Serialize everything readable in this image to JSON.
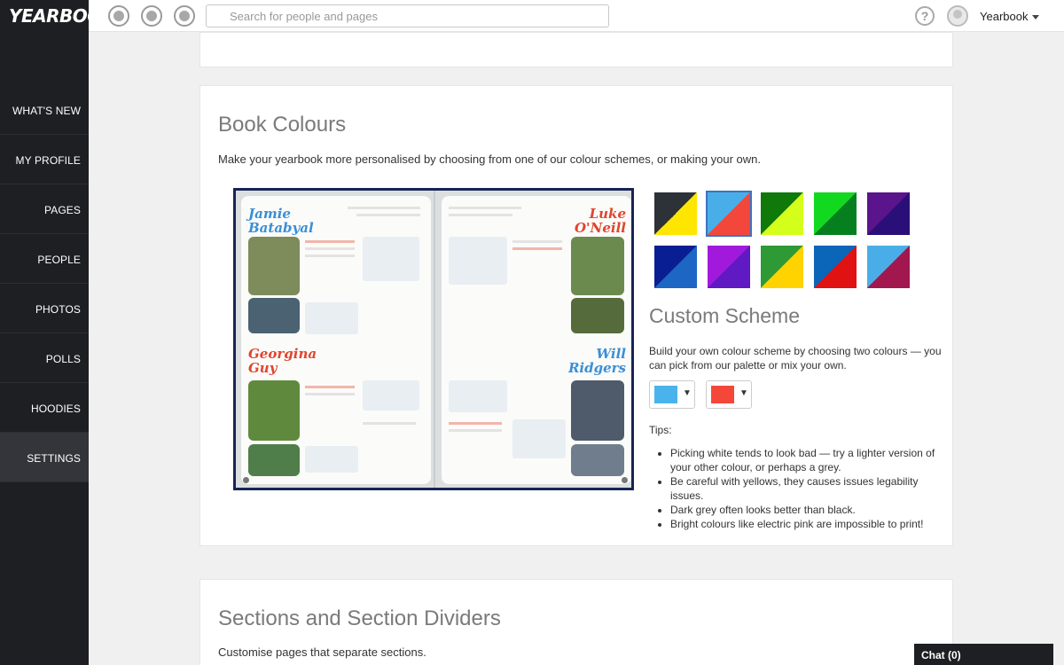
{
  "app": {
    "logo_text": "YEARBOOK"
  },
  "topbar": {
    "search_placeholder": "Search for people and pages",
    "help_label": "?",
    "user_name": "Yearbook"
  },
  "sidebar": {
    "items": [
      {
        "label": "WHAT'S NEW",
        "active": false
      },
      {
        "label": "MY PROFILE",
        "active": false
      },
      {
        "label": "PAGES",
        "active": false
      },
      {
        "label": "PEOPLE",
        "active": false
      },
      {
        "label": "PHOTOS",
        "active": false
      },
      {
        "label": "POLLS",
        "active": false
      },
      {
        "label": "HOODIES",
        "active": false
      },
      {
        "label": "SETTINGS",
        "active": true
      }
    ]
  },
  "book_colours": {
    "title": "Book Colours",
    "intro": "Make your yearbook more personalised by choosing from one of our colour schemes, or making your own.",
    "preview": {
      "names": [
        "Jamie Batabyal",
        "Luke O'Neill",
        "Georgina Guy",
        "Will Ridgers"
      ]
    },
    "schemes": [
      {
        "a": "#2d3238",
        "b": "#ffe600",
        "selected": false
      },
      {
        "a": "#49aee8",
        "b": "#f2473a",
        "selected": true
      },
      {
        "a": "#0f7a0a",
        "b": "#d4ff1a",
        "selected": false
      },
      {
        "a": "#13d820",
        "b": "#06801f",
        "selected": false
      },
      {
        "a": "#5a148c",
        "b": "#2a0f78",
        "selected": false
      },
      {
        "a": "#0a1e93",
        "b": "#1e66c4",
        "selected": false
      },
      {
        "a": "#a11adc",
        "b": "#5f1ac4",
        "selected": false
      },
      {
        "a": "#2e9a35",
        "b": "#ffd300",
        "selected": false
      },
      {
        "a": "#0b65b8",
        "b": "#e01212",
        "selected": false
      },
      {
        "a": "#49aee8",
        "b": "#a3174f",
        "selected": false
      }
    ],
    "custom": {
      "title": "Custom Scheme",
      "description": "Build your own colour scheme by choosing two colours — you can pick from our palette or mix your own.",
      "colour_one": "#4ab3ec",
      "colour_two": "#f4473a",
      "arrow": "▼"
    },
    "tips_title": "Tips:",
    "tips": [
      "Picking white tends to look bad — try a lighter version of your other colour, or perhaps a grey.",
      "Be careful with yellows, they causes issues legability issues.",
      "Dark grey often looks better than black.",
      "Bright colours like electric pink are impossible to print!"
    ]
  },
  "sections": {
    "title": "Sections and Section Dividers",
    "intro": "Customise pages that separate sections."
  },
  "chat": {
    "label": "Chat (0)"
  }
}
